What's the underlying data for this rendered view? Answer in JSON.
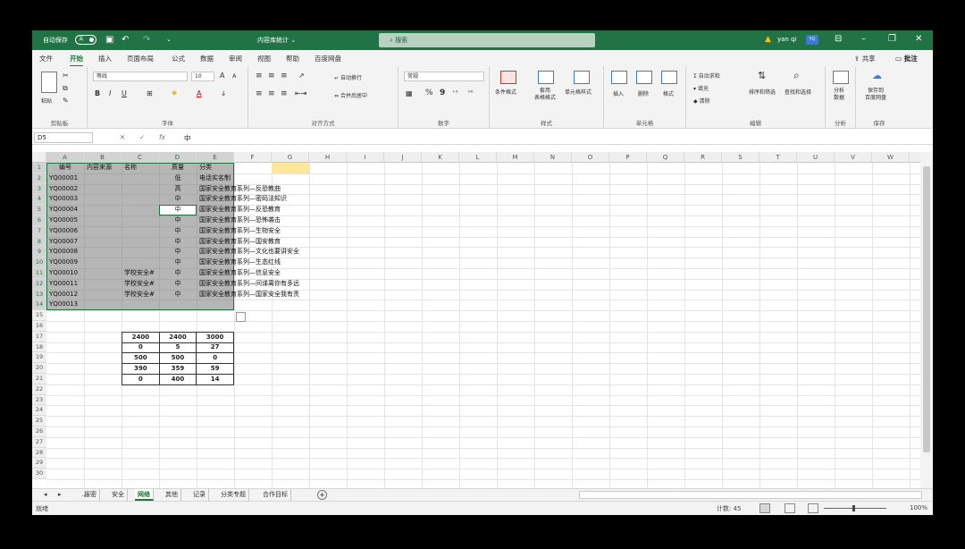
{
  "titlebar": {
    "autosave_label": "自动保存",
    "autosave_state": "关",
    "doc_title": "内容库统计",
    "doc_title_arrow": "⌄",
    "search_placeholder": "搜索",
    "user_name": "yan qi",
    "user_initials": "YQ"
  },
  "ribbon_tabs": [
    "文件",
    "开始",
    "插入",
    "页面布局",
    "公式",
    "数据",
    "审阅",
    "视图",
    "帮助",
    "百度网盘"
  ],
  "active_tab": "开始",
  "share_label": "共享",
  "comment_label": "批注",
  "ribbon": {
    "clipboard": {
      "group": "剪贴板",
      "paste": "粘贴"
    },
    "font": {
      "group": "字体",
      "name": "等线",
      "size": "10",
      "bold": "B",
      "italic": "I",
      "underline": "U",
      "grow": "A",
      "shrink": "A",
      "color_letter": "A"
    },
    "alignment": {
      "group": "对齐方式",
      "wrap": "自动换行",
      "merge": "合并后居中"
    },
    "number": {
      "group": "数字",
      "format": "常规",
      "percent": "%",
      "comma": "9"
    },
    "styles": {
      "group": "样式",
      "cond": "条件格式",
      "table": "套用\n表格格式",
      "cell": "单元格样式"
    },
    "cells": {
      "group": "单元格",
      "insert": "插入",
      "delete": "删除",
      "format": "格式"
    },
    "editing": {
      "group": "编辑",
      "autosum": "自动求和",
      "fill": "填充",
      "clear": "清除",
      "sort": "排序和筛选",
      "find": "查找和选择"
    },
    "analysis": {
      "group": "分析",
      "analyze": "分析\n数据"
    },
    "save": {
      "group": "保存",
      "baidu": "保存到\n百度网盘"
    }
  },
  "formula_bar": {
    "cell_ref": "D5",
    "cancel": "✕",
    "enter": "✓",
    "fx": "fx",
    "value": "中"
  },
  "columns": [
    "A",
    "B",
    "C",
    "D",
    "E",
    "F",
    "G",
    "H",
    "I",
    "J",
    "K",
    "L",
    "M",
    "N",
    "O",
    "P",
    "Q",
    "R",
    "S",
    "T",
    "U",
    "V",
    "W"
  ],
  "rows": [
    "1",
    "2",
    "3",
    "4",
    "5",
    "6",
    "7",
    "8",
    "9",
    "10",
    "11",
    "12",
    "13",
    "14",
    "15",
    "16",
    "17",
    "18",
    "19",
    "20",
    "21",
    "22",
    "23",
    "24",
    "25",
    "26",
    "27",
    "28",
    "29",
    "30"
  ],
  "headers": {
    "A": "编号",
    "B": "内容来源",
    "C": "名称",
    "D": "质量",
    "E": "分类"
  },
  "ids": [
    "YQ00001",
    "YQ00002",
    "YQ00003",
    "YQ00004",
    "YQ00005",
    "YQ00006",
    "YQ00007",
    "YQ00008",
    "YQ00009",
    "YQ00010",
    "YQ00011",
    "YQ00012",
    "YQ00013"
  ],
  "quality": [
    "低",
    "高",
    "中",
    "中",
    "中",
    "中",
    "中",
    "中",
    "中",
    "中",
    "中",
    "中"
  ],
  "names": {
    "11": "学校安全#",
    "12": "学校安全#",
    "13": "学校安全#"
  },
  "categories": [
    "电话实名制",
    "国家安全教育系列—反恐教曲",
    "国家安全教育系列—密码法知识",
    "国家安全教育系列—反恐教育",
    "国家安全教育系列—恐怖袭击",
    "国家安全教育系列—生物安全",
    "国家安全教育系列—国安教育",
    "国家安全教育系列—文化也要讲安全",
    "国家安全教育系列—生态红线",
    "国家安全教育系列—信息安全",
    "国家安全教育系列—间谍离你有多远",
    "国家安全教育系列—国家安全我有责"
  ],
  "numeric_table": [
    [
      "2400",
      "2400",
      "3000"
    ],
    [
      "0",
      "5",
      "27"
    ],
    [
      "500",
      "500",
      "0"
    ],
    [
      "390",
      "359",
      "59"
    ],
    [
      "0",
      "400",
      "14"
    ]
  ],
  "sheet_tabs": [
    "报密",
    "安全",
    "网络",
    "其他",
    "记录",
    "分类专题",
    "合作目标"
  ],
  "active_sheet": "网络",
  "status": {
    "mode": "就绪",
    "count": "计数: 45",
    "zoom": "100%"
  },
  "colors": {
    "brand_green": "#217346",
    "selection_gray": "#6e6e6e",
    "highlight_yellow": "#ffe699"
  }
}
